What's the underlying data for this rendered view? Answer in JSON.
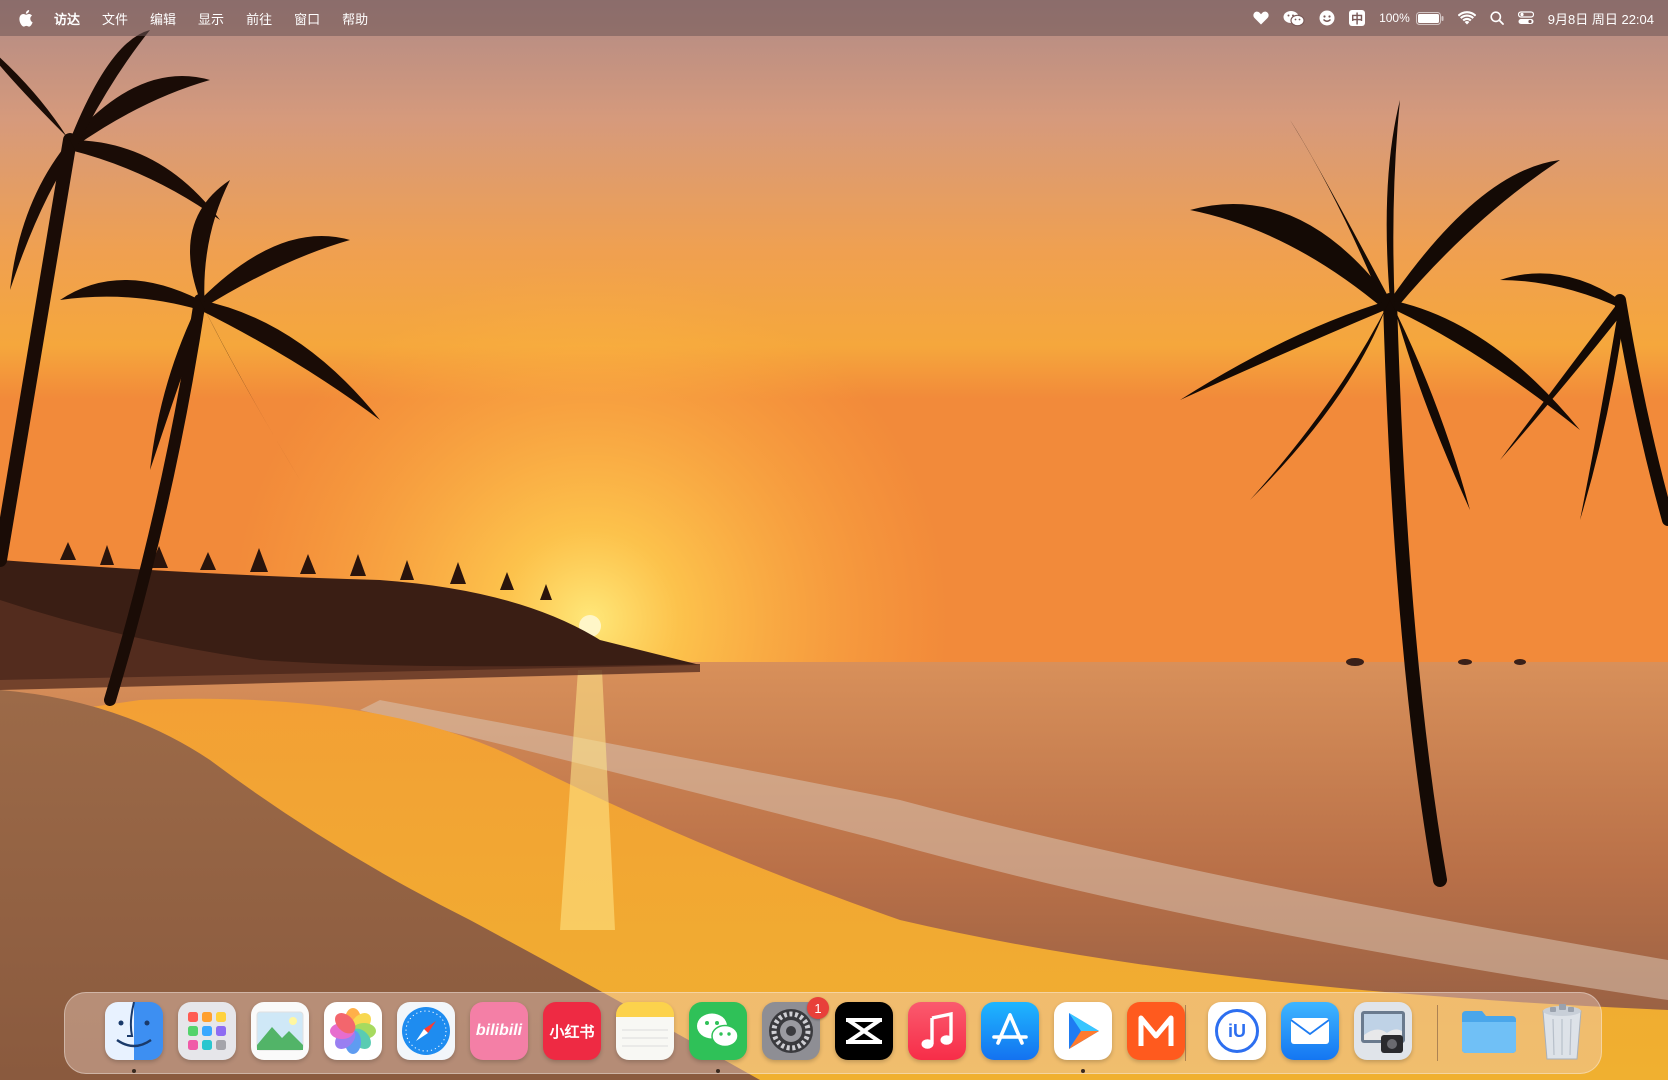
{
  "menubar": {
    "apple_icon": "apple-logo-icon",
    "app_name": "访达",
    "menus": [
      "文件",
      "编辑",
      "显示",
      "前往",
      "窗口",
      "帮助"
    ],
    "status": {
      "icons": [
        "heart-icon",
        "wechat-icon",
        "smile-icon",
        "input-method-icon",
        "battery-icon",
        "wifi-icon",
        "search-icon",
        "control-center-icon"
      ],
      "input_method": "中",
      "battery_percent": "100%",
      "battery_level": 1.0,
      "clock": "9月8日 周日 22:04"
    }
  },
  "dock": {
    "apps": [
      {
        "name": "Finder",
        "icon": "finder-icon",
        "running": true
      },
      {
        "name": "Launchpad",
        "icon": "launchpad-icon",
        "running": false
      },
      {
        "name": "Preview",
        "icon": "preview-icon",
        "running": false
      },
      {
        "name": "Photos",
        "icon": "photos-icon",
        "running": false
      },
      {
        "name": "Safari",
        "icon": "safari-icon",
        "running": false
      },
      {
        "name": "bilibili",
        "icon": "bilibili-icon",
        "running": false,
        "label": "bilibili"
      },
      {
        "name": "小红书",
        "icon": "xiaohongshu-icon",
        "running": false,
        "label": "小红书"
      },
      {
        "name": "Notes",
        "icon": "notes-icon",
        "running": false
      },
      {
        "name": "WeChat",
        "icon": "wechat-icon",
        "running": true
      },
      {
        "name": "System Settings",
        "icon": "settings-gear-icon",
        "running": false,
        "badge": "1"
      },
      {
        "name": "CapCut",
        "icon": "capcut-icon",
        "running": false
      },
      {
        "name": "Music",
        "icon": "music-icon",
        "running": false
      },
      {
        "name": "App Store",
        "icon": "app-store-icon",
        "running": false
      },
      {
        "name": "Infuse",
        "icon": "infuse-icon",
        "running": true
      },
      {
        "name": "Mango TV",
        "icon": "mango-tv-icon",
        "running": false
      }
    ],
    "secondary": [
      {
        "name": "Baidu Netdisk",
        "icon": "baidu-netdisk-icon",
        "label": "iU"
      },
      {
        "name": "Mail",
        "icon": "mail-icon"
      },
      {
        "name": "Screenshot Utility",
        "icon": "screenshot-app-icon"
      }
    ],
    "folder": {
      "name": "Downloads",
      "icon": "folder-icon"
    },
    "trash": {
      "name": "Trash",
      "icon": "trash-icon"
    }
  },
  "colors": {
    "sky_top": "#b98f88",
    "sky_mid": "#f0a050",
    "sun": "#ffe070",
    "sea": "#c86a3a",
    "sand": "#a46a42"
  }
}
